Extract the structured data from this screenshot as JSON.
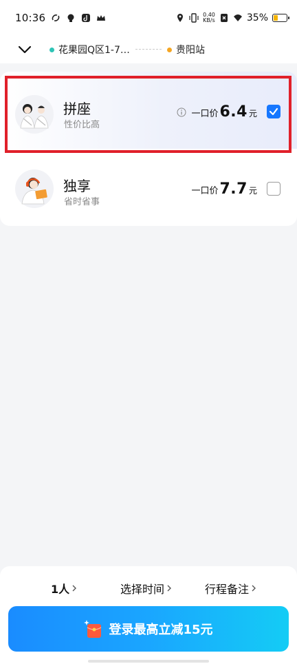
{
  "status_bar": {
    "time": "10:36",
    "net_speed_top": "0.40",
    "net_speed_bottom": "KB/s",
    "battery_percent": "35%",
    "battery_level": 0.35,
    "battery_color": "#f5b400"
  },
  "route": {
    "origin": "花果园Q区1-7…",
    "destination": "贵阳站",
    "origin_dot_color": "#2ec4b6",
    "destination_dot_color": "#f5a623"
  },
  "options": [
    {
      "title": "拼座",
      "subtitle": "性价比高",
      "price_prefix": "一口价",
      "price": "6.4",
      "unit": "元",
      "checked": true,
      "has_info": true
    },
    {
      "title": "独享",
      "subtitle": "省时省事",
      "price_prefix": "一口价",
      "price": "7.7",
      "unit": "元",
      "checked": false,
      "has_info": false
    }
  ],
  "bottom": {
    "passengers": "1人",
    "choose_time": "选择时间",
    "trip_note": "行程备注",
    "login_cta": "登录最高立减15元"
  },
  "colors": {
    "accent": "#1677ff",
    "highlight": "#e0202a"
  }
}
